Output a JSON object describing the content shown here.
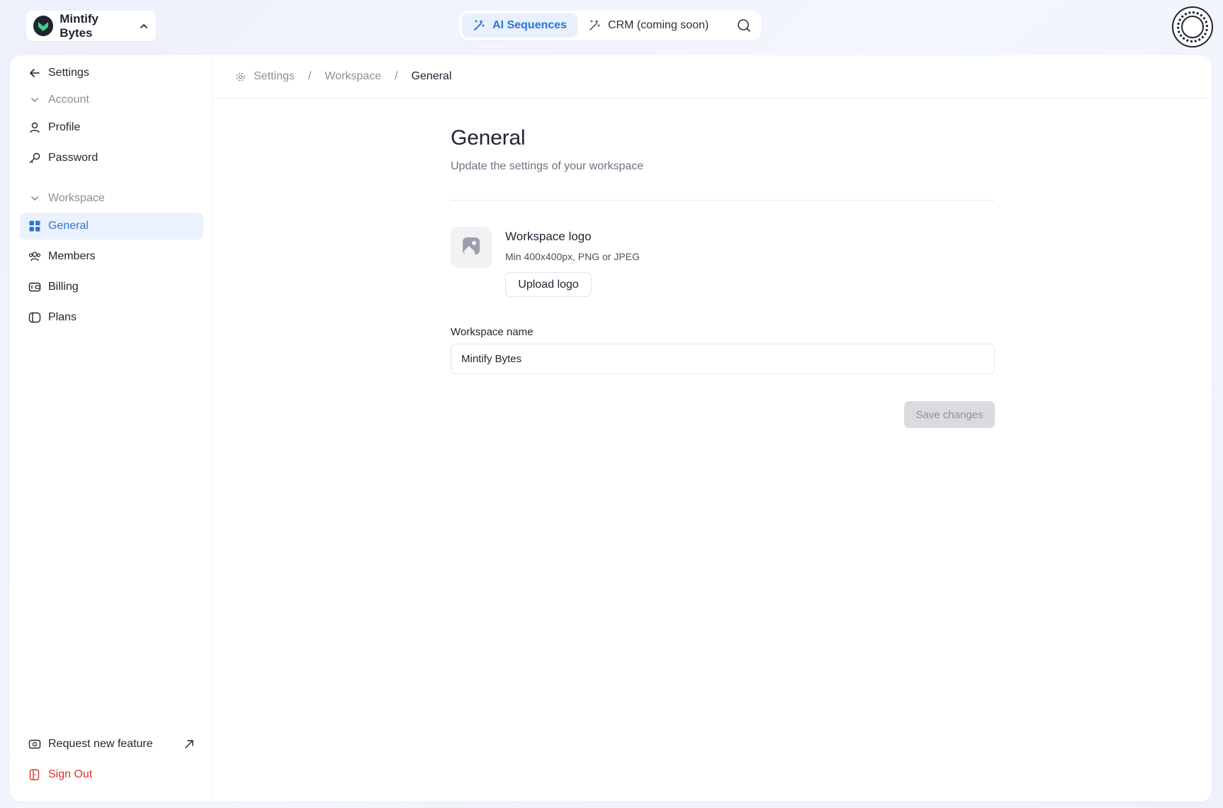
{
  "workspace": {
    "name": "Mintify Bytes",
    "logo_color": "#3ecf8e"
  },
  "topnav": {
    "items": [
      {
        "label": "AI Sequences",
        "icon": "magic-wand-icon",
        "active": true
      },
      {
        "label": "CRM (coming soon)",
        "icon": "sparkle-wand-icon",
        "active": false
      }
    ],
    "search_icon": "search-icon"
  },
  "sidebar": {
    "back_label": "Settings",
    "groups": [
      {
        "label": "Account",
        "items": [
          {
            "label": "Profile",
            "icon": "user-icon"
          },
          {
            "label": "Password",
            "icon": "key-icon"
          }
        ]
      },
      {
        "label": "Workspace",
        "items": [
          {
            "label": "General",
            "icon": "grid-icon",
            "active": true
          },
          {
            "label": "Members",
            "icon": "users-icon"
          },
          {
            "label": "Billing",
            "icon": "wallet-icon"
          },
          {
            "label": "Plans",
            "icon": "tag-icon"
          }
        ]
      }
    ],
    "footer": [
      {
        "label": "Request new feature",
        "icon": "ticket-icon"
      },
      {
        "label": "Sign Out",
        "icon": "door-icon",
        "color": "#d9342b"
      }
    ]
  },
  "breadcrumb": {
    "items": [
      "Settings",
      "Workspace",
      "General"
    ],
    "separator": "/"
  },
  "main": {
    "title": "General",
    "subtitle": "Update the settings of your workspace",
    "logo_section": {
      "title": "Workspace logo",
      "hint": "Min 400x400px, PNG or JPEG",
      "upload_label": "Upload logo"
    },
    "name_field": {
      "label": "Workspace name",
      "value": "Mintify Bytes"
    },
    "save_label": "Save changes"
  },
  "colors": {
    "accent": "#2f74d6",
    "accent_bg": "#eaf2fd",
    "danger": "#d9342b"
  }
}
